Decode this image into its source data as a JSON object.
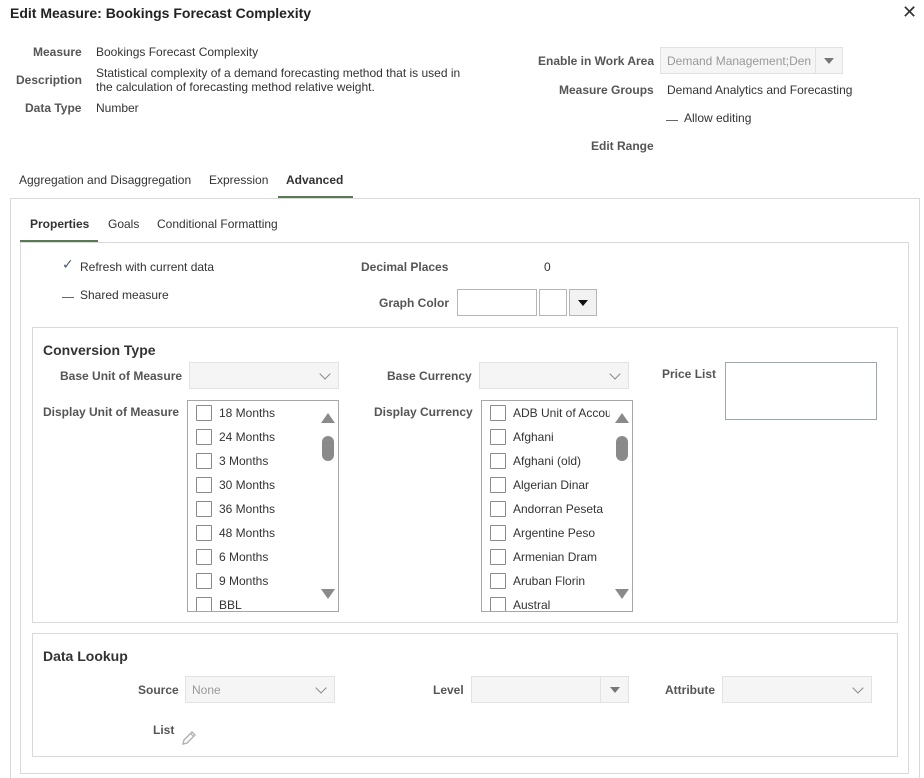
{
  "dialog": {
    "title": "Edit Measure: Bookings Forecast Complexity",
    "close_label": "✕"
  },
  "info": {
    "measure_label": "Measure",
    "measure_value": "Bookings Forecast Complexity",
    "description_label": "Description",
    "description_value": "Statistical complexity of a demand forecasting method that is used in the calculation of forecasting method relative weight.",
    "data_type_label": "Data Type",
    "data_type_value": "Number",
    "enable_label": "Enable in Work Area",
    "enable_value": "Demand Management;Den",
    "groups_label": "Measure Groups",
    "groups_value": "Demand Analytics and Forecasting",
    "allow_editing": "Allow editing",
    "edit_range_label": "Edit Range"
  },
  "tabs": {
    "aggregation": "Aggregation and Disaggregation",
    "expression": "Expression",
    "advanced": "Advanced"
  },
  "subtabs": {
    "properties": "Properties",
    "goals": "Goals",
    "conditional": "Conditional Formatting"
  },
  "properties": {
    "refresh_label": "Refresh with current data",
    "check_mark": "✓",
    "shared_label": "Shared measure",
    "decimal_label": "Decimal Places",
    "decimal_value": "0",
    "graph_color_label": "Graph Color"
  },
  "conversion": {
    "title": "Conversion Type",
    "base_uom_label": "Base Unit of Measure",
    "base_currency_label": "Base Currency",
    "price_list_label": "Price List",
    "display_uom_label": "Display Unit of Measure",
    "display_currency_label": "Display Currency",
    "uom_items": [
      "18 Months",
      "24 Months",
      "3 Months",
      "30 Months",
      "36 Months",
      "48 Months",
      "6 Months",
      "9 Months",
      "BBL"
    ],
    "currency_items": [
      "ADB Unit of Accou",
      "Afghani",
      "Afghani (old)",
      "Algerian Dinar",
      "Andorran Peseta",
      "Argentine Peso",
      "Armenian Dram",
      "Aruban Florin",
      "Austral"
    ]
  },
  "lookup": {
    "title": "Data Lookup",
    "source_label": "Source",
    "source_value": "None",
    "level_label": "Level",
    "attribute_label": "Attribute",
    "list_label": "List"
  },
  "icons": {
    "close": "close-icon",
    "dropdown": "dropdown-arrow-icon",
    "check": "checkmark-icon",
    "scroll_up": "scroll-up-icon",
    "scroll_down": "scroll-down-icon",
    "edit": "pencil-icon"
  },
  "colors": {
    "accent_underline": "#5a7a55",
    "border": "#d9d9d9",
    "disabled_bg": "#f5f5f5"
  }
}
